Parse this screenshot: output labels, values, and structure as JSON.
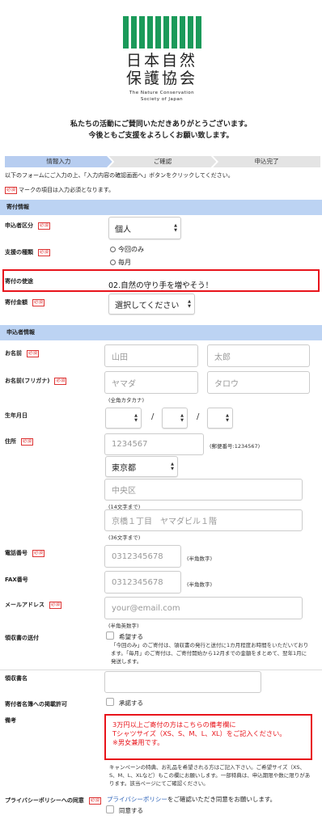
{
  "logo": {
    "kanji_line1": "日本自然",
    "kanji_line2": "保護協会",
    "en_line1": "The Nature Conservation",
    "en_line2": "Society of Japan",
    "color": "#1b9a5a"
  },
  "thanks": {
    "line1": "私たちの活動にご賛同いただきありがとうございます。",
    "line2": "今後ともご支援をよろしくお願い致します。"
  },
  "steps": [
    "情報入力",
    "ご確認",
    "申込完了"
  ],
  "intro": "以下のフォームにご入力の上、「入力内容の確認画面へ」ボタンをクリックしてください。",
  "required_badge": "必須",
  "required_note": "マークの項目は入力必須となります。",
  "donation_section": {
    "title": "寄付情報",
    "applicant_type": {
      "label": "申込者区分",
      "value": "個人"
    },
    "support_type": {
      "label": "支援の種類",
      "options": [
        "今回のみ",
        "毎月"
      ]
    },
    "purpose": {
      "label": "寄付の使途",
      "value": "02.自然の守り手を増やそう！"
    },
    "amount": {
      "label": "寄付金額",
      "value": "選択してください"
    }
  },
  "applicant_section": {
    "title": "申込者情報",
    "name": {
      "label": "お名前",
      "last": "山田",
      "first": "太郎"
    },
    "kana": {
      "label": "お名前(フリガナ)",
      "last": "ヤマダ",
      "first": "タロウ",
      "hint": "(全角カタカナ)"
    },
    "birthday": {
      "label": "生年月日",
      "sep": "/"
    },
    "address": {
      "label": "住所",
      "zip": "1234567",
      "zip_hint": "(郵便番号:1234567)",
      "prefecture": "東京都",
      "city": "中央区",
      "city_hint": "(14文字まで)",
      "street": "京橋１丁目　ヤマダビル１階",
      "street_hint": "(36文字まで)"
    },
    "phone": {
      "label": "電話番号",
      "value": "0312345678",
      "hint": "(半角数字)"
    },
    "fax": {
      "label": "FAX番号",
      "value": "0312345678",
      "hint": "(半角数字)"
    },
    "email": {
      "label": "メールアドレス",
      "placeholder": "your@email.com",
      "hint": "(半角英数字)"
    },
    "receipt": {
      "label": "領収書の送付",
      "checkbox_label": "希望する",
      "note": "「今回のみ」のご寄付は、領収書の発行と送付に1カ月程度お時間をいただいております。「毎月」のご寄付は、ご寄付開始から12月までの金額をまとめて、翌年1月に発送します。"
    },
    "receipt_name": {
      "label": "領収書名"
    },
    "listing": {
      "label": "寄付者名簿への掲載許可",
      "checkbox_label": "承諾する"
    },
    "remarks": {
      "label": "備考",
      "text_line1": "3万円以上ご寄付の方はこちらの備考欄に",
      "text_line2": "Tシャツサイズ（XS、S、M、L、XL）をご記入ください。",
      "text_line3": "※男女兼用です。",
      "note": "キャンペーンの特典、お礼品を希望される方はご記入下さい。ご希望サイズ（XS、S、M、L、XLなど）もこの欄にお願いします。一部特典は、申込期限や数に限りがあります。該当ページにてご確認ください。"
    },
    "privacy": {
      "label": "プライバシーポリシーへの同意",
      "link_text": "プライバシーポリシー",
      "text_after": "をご確認いただき同意をお願いします。",
      "checkbox_label": "同意する"
    }
  },
  "colors": {
    "section_bg": "#bcd3f3",
    "highlight": "#e8141b",
    "required": "#d33"
  }
}
